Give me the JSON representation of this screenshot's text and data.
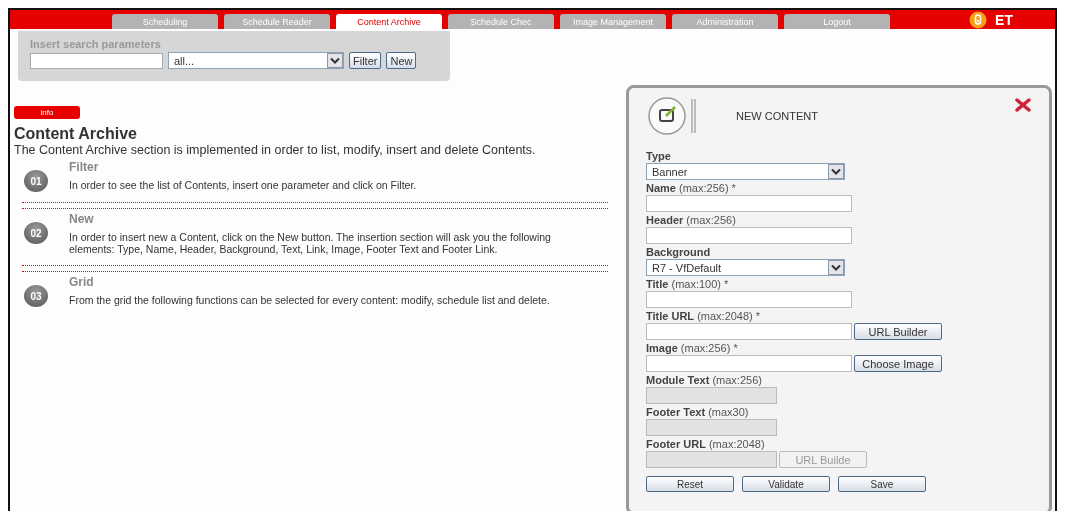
{
  "tabs": [
    {
      "label": "Scheduling",
      "selected": false
    },
    {
      "label": "Schedule Reader",
      "selected": false
    },
    {
      "label": "Content Archive",
      "selected": true
    },
    {
      "label": "Schedule Chec",
      "selected": false
    },
    {
      "label": "Image Management",
      "selected": false
    },
    {
      "label": "Administration",
      "selected": false
    },
    {
      "label": "Logout",
      "selected": false
    }
  ],
  "logo": {
    "text": "ET"
  },
  "search": {
    "title": "Insert search parameters",
    "select_value": "all...",
    "buttons": [
      "Filter",
      "New"
    ]
  },
  "info": {
    "badge": "info",
    "title": "Content Archive",
    "intro": "The Content Archive section is implemented in order to list, modify, insert and delete Contents.",
    "steps": [
      {
        "number": "01",
        "title": "Filter",
        "text": "In order to see the list of Contents, insert one parameter and click on Filter."
      },
      {
        "number": "02",
        "title": "New",
        "text": "In order to insert new a Content, click on the New button. The insertion section will ask you the following elements: Type, Name, Header, Background, Text, Link, Image, Footer Text and Footer Link."
      },
      {
        "number": "03",
        "title": "Grid",
        "text": "From the grid the following functions can be selected for every content: modify, schedule list and delete."
      }
    ]
  },
  "panel": {
    "title": "NEW CONTENT",
    "fields": [
      {
        "label": "**Type**",
        "kind": "select",
        "value": "Banner",
        "disabled": false
      },
      {
        "label": "**Name** (max:256) *",
        "kind": "text",
        "disabled": false
      },
      {
        "label": "**Header** (max:256)",
        "kind": "text",
        "disabled": false
      },
      {
        "label": "**Background**",
        "kind": "select",
        "value": "R7 - VfDefault",
        "disabled": false
      },
      {
        "label": "**Title** (max:100) *",
        "kind": "text",
        "disabled": false
      },
      {
        "label": "**Title URL** (max:2048) *",
        "kind": "text_button",
        "button": "URL Builder",
        "disabled": false
      },
      {
        "label": "**Image** (max:256) *",
        "kind": "text_button",
        "button": "Choose Image",
        "disabled": false
      },
      {
        "label": "**Module Text** (max:256)",
        "kind": "short",
        "disabled": true
      },
      {
        "label": "**Footer Text** (max30)",
        "kind": "short",
        "disabled": true
      },
      {
        "label": "**Footer URL** (max:2048)",
        "kind": "short_button",
        "button": "URL Builde",
        "disabled": true
      }
    ],
    "buttons": [
      "Reset",
      "Validate",
      "Save"
    ]
  }
}
